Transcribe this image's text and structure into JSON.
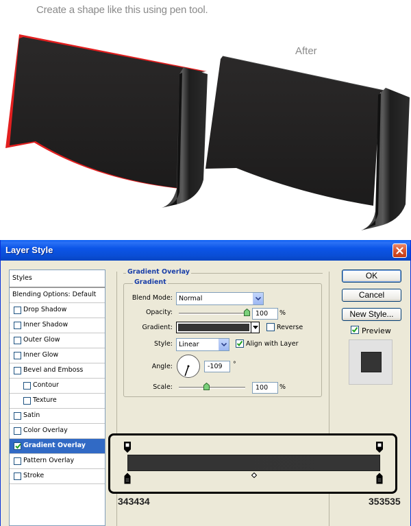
{
  "illustration": {
    "caption": "Create a shape like this using pen tool.",
    "after_label": "After"
  },
  "dialog": {
    "title": "Layer Style",
    "styles_list": {
      "header": "Styles",
      "items": [
        {
          "label": "Blending Options: Default",
          "checkbox": false,
          "checked": false,
          "selected": false,
          "indent": false
        },
        {
          "label": "Drop Shadow",
          "checkbox": true,
          "checked": false,
          "selected": false,
          "indent": false
        },
        {
          "label": "Inner Shadow",
          "checkbox": true,
          "checked": false,
          "selected": false,
          "indent": false
        },
        {
          "label": "Outer Glow",
          "checkbox": true,
          "checked": false,
          "selected": false,
          "indent": false
        },
        {
          "label": "Inner Glow",
          "checkbox": true,
          "checked": false,
          "selected": false,
          "indent": false
        },
        {
          "label": "Bevel and Emboss",
          "checkbox": true,
          "checked": false,
          "selected": false,
          "indent": false
        },
        {
          "label": "Contour",
          "checkbox": true,
          "checked": false,
          "selected": false,
          "indent": true
        },
        {
          "label": "Texture",
          "checkbox": true,
          "checked": false,
          "selected": false,
          "indent": true
        },
        {
          "label": "Satin",
          "checkbox": true,
          "checked": false,
          "selected": false,
          "indent": false
        },
        {
          "label": "Color Overlay",
          "checkbox": true,
          "checked": false,
          "selected": false,
          "indent": false
        },
        {
          "label": "Gradient Overlay",
          "checkbox": true,
          "checked": true,
          "selected": true,
          "indent": false
        },
        {
          "label": "Pattern Overlay",
          "checkbox": true,
          "checked": false,
          "selected": false,
          "indent": false
        },
        {
          "label": "Stroke",
          "checkbox": true,
          "checked": false,
          "selected": false,
          "indent": false
        }
      ]
    },
    "panel": {
      "section_title": "Gradient Overlay",
      "group_title": "Gradient",
      "blend_mode": {
        "label": "Blend Mode:",
        "value": "Normal"
      },
      "opacity": {
        "label": "Opacity:",
        "value": "100",
        "unit": "%",
        "slider_fraction": 1.0
      },
      "gradient": {
        "label": "Gradient:",
        "reverse_label": "Reverse",
        "reverse_checked": false
      },
      "style": {
        "label": "Style:",
        "value": "Linear",
        "align_label": "Align with Layer",
        "align_checked": true
      },
      "angle": {
        "label": "Angle:",
        "value": "-109",
        "unit": "°",
        "degrees": -109
      },
      "scale": {
        "label": "Scale:",
        "value": "100",
        "unit": "%",
        "slider_fraction": 0.42
      }
    },
    "buttons": {
      "ok": "OK",
      "cancel": "Cancel",
      "new_style": "New Style...",
      "preview_label": "Preview",
      "preview_checked": true
    },
    "gradient_editor": {
      "left_stop_color": "343434",
      "right_stop_color": "353535"
    }
  },
  "colors": {
    "shape_dark": "#232323",
    "shape_outline": "#e21f1f",
    "titlebar": "#0a4ed6",
    "selection": "#316ac5",
    "dialog_bg": "#ece9d8"
  }
}
